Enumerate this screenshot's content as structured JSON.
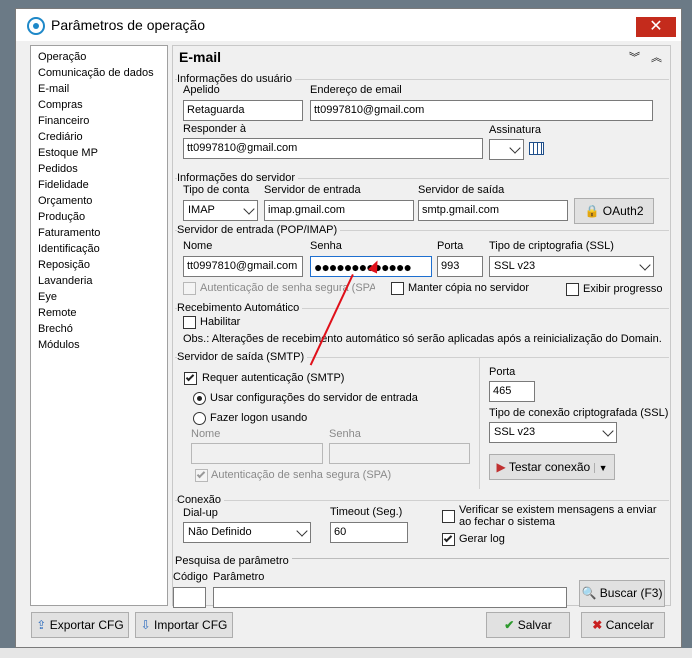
{
  "window": {
    "title": "Parâmetros de operação",
    "close": "✕"
  },
  "sidebar": {
    "items": [
      "Operação",
      "Comunicação de dados",
      "E-mail",
      "Compras",
      "Financeiro",
      "Crediário",
      "Estoque MP",
      "Pedidos",
      "Fidelidade",
      "Orçamento",
      "Produção",
      "Faturamento",
      "Identificação",
      "Reposição",
      "Lavanderia",
      "Eye",
      "Remote",
      "Brechó",
      "Módulos"
    ]
  },
  "section_title": "E-mail",
  "user_info": {
    "group": "Informações do usuário",
    "nickname_label": "Apelido",
    "nickname": "Retaguarda",
    "email_label": "Endereço de email",
    "email": "tt0997810@gmail.com",
    "reply_label": "Responder à",
    "reply": "tt0997810@gmail.com",
    "signature_label": "Assinatura"
  },
  "server_info": {
    "group": "Informações do servidor",
    "account_type_label": "Tipo de conta",
    "account_type": "IMAP",
    "incoming_label": "Servidor de entrada",
    "incoming": "imap.gmail.com",
    "outgoing_label": "Servidor de saída",
    "outgoing": "smtp.gmail.com",
    "oauth_button": "OAuth2"
  },
  "incoming_server": {
    "group": "Servidor de entrada (POP/IMAP)",
    "name_label": "Nome",
    "name": "tt0997810@gmail.com",
    "password_label": "Senha",
    "password": "●●●●●●●●●●●●●",
    "port_label": "Porta",
    "port": "993",
    "ssl_label": "Tipo de criptografia (SSL)",
    "ssl": "SSL v23",
    "spa": "Autenticação de senha segura (SPA)",
    "keep_copy": "Manter cópia no servidor",
    "show_progress": "Exibir progresso"
  },
  "auto_receive": {
    "group": "Recebimento Automático",
    "enable": "Habilitar",
    "note": "Obs.:  Alterações de recebimento automático só serão aplicadas após a reinicialização do Domain."
  },
  "smtp": {
    "group": "Servidor de saída (SMTP)",
    "requires_auth": "Requer autenticação (SMTP)",
    "use_incoming": "Usar configurações do servidor de entrada",
    "logon_using": "Fazer logon usando",
    "name_label": "Nome",
    "password_label": "Senha",
    "spa": "Autenticação de senha segura (SPA)",
    "port_label": "Porta",
    "port": "465",
    "conn_type_label": "Tipo de conexão criptografada  (SSL)",
    "conn_type": "SSL v23",
    "test_button": "Testar conexão"
  },
  "connection": {
    "group": "Conexão",
    "dialup_label": "Dial-up",
    "dialup": "Não Definido",
    "timeout_label": "Timeout (Seg.)",
    "timeout": "60",
    "check_on_close": "Verificar se existem mensagens a enviar ao fechar o sistema",
    "gen_log": "Gerar log"
  },
  "search": {
    "group": "Pesquisa de parâmetro",
    "code_label": "Código",
    "param_label": "Parâmetro",
    "search_button": "Buscar (F3)"
  },
  "footer": {
    "export": "Exportar CFG",
    "import": "Importar CFG",
    "save": "Salvar",
    "cancel": "Cancelar"
  }
}
